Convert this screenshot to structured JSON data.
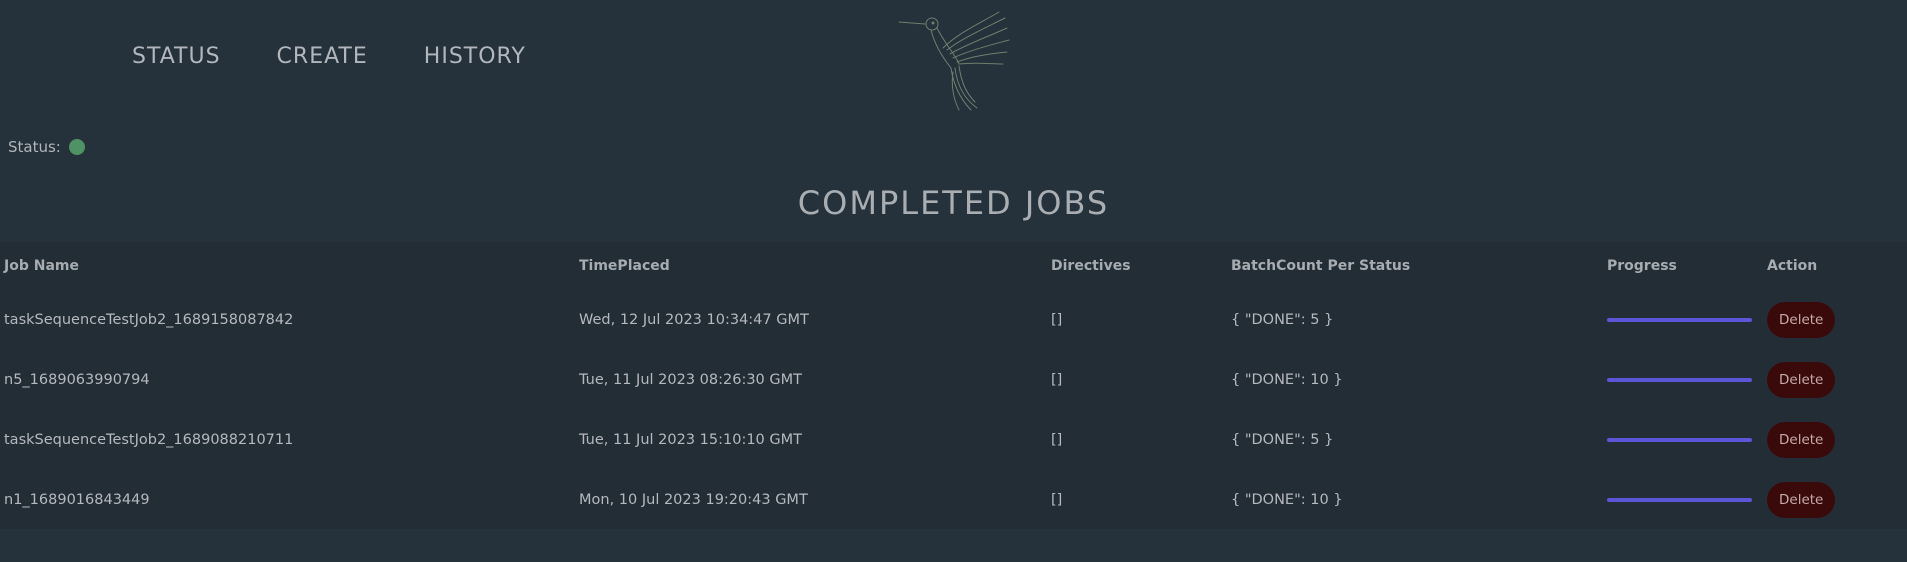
{
  "nav": {
    "items": [
      {
        "label": "STATUS"
      },
      {
        "label": "CREATE"
      },
      {
        "label": "HISTORY"
      }
    ]
  },
  "logo": {
    "icon": "hummingbird-icon",
    "color": "#6f7f6e"
  },
  "status": {
    "label": "Status:",
    "indicator_color": "#4f9264"
  },
  "page": {
    "title": "COMPLETED JOBS"
  },
  "table": {
    "headers": {
      "name": "Job Name",
      "time": "TimePlaced",
      "directives": "Directives",
      "batch": "BatchCount Per Status",
      "progress": "Progress",
      "action": "Action"
    },
    "rows": [
      {
        "name": "taskSequenceTestJob2_1689158087842",
        "time": "Wed, 12 Jul 2023 10:34:47 GMT",
        "directives": "[]",
        "batch": "{ \"DONE\": 5 }",
        "progress": 100,
        "action": "Delete"
      },
      {
        "name": "n5_1689063990794",
        "time": "Tue, 11 Jul 2023 08:26:30 GMT",
        "directives": "[]",
        "batch": "{ \"DONE\": 10 }",
        "progress": 100,
        "action": "Delete"
      },
      {
        "name": "taskSequenceTestJob2_1689088210711",
        "time": "Tue, 11 Jul 2023 15:10:10 GMT",
        "directives": "[]",
        "batch": "{ \"DONE\": 5 }",
        "progress": 100,
        "action": "Delete"
      },
      {
        "name": "n1_1689016843449",
        "time": "Mon, 10 Jul 2023 19:20:43 GMT",
        "directives": "[]",
        "batch": "{ \"DONE\": 10 }",
        "progress": 100,
        "action": "Delete"
      }
    ]
  },
  "colors": {
    "background": "#25313b",
    "table_background": "#222d36",
    "progress": "#5b56d8",
    "delete_button": "#3a0a0a"
  }
}
